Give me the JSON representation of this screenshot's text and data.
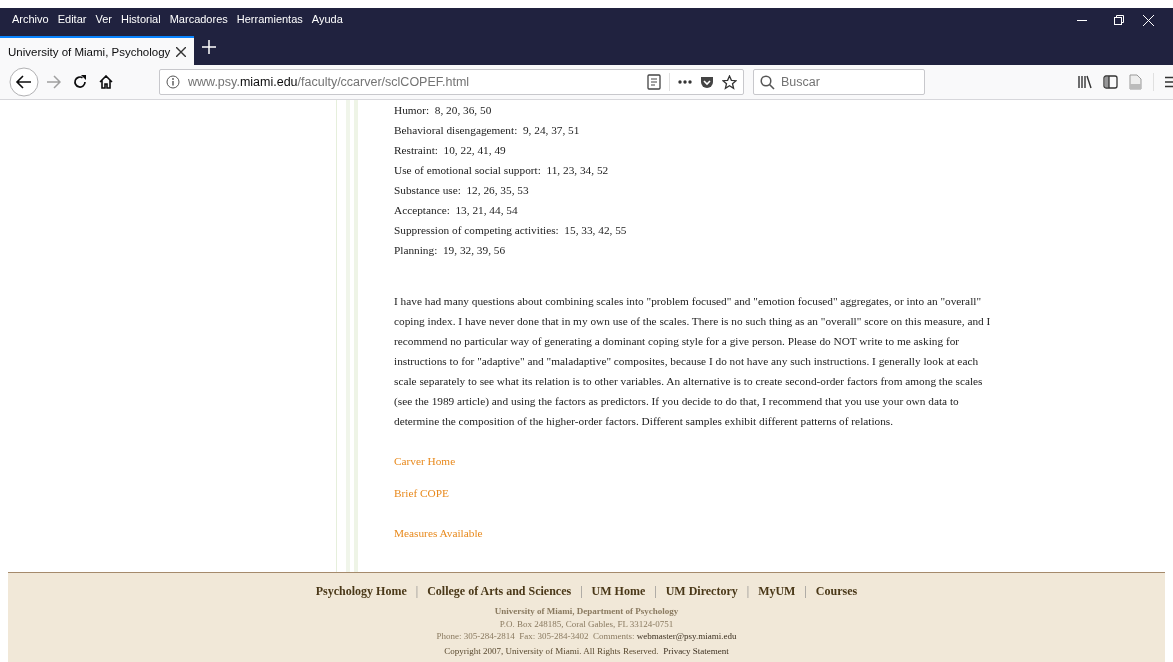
{
  "menu": [
    "Archivo",
    "Editar",
    "Ver",
    "Historial",
    "Marcadores",
    "Herramientas",
    "Ayuda"
  ],
  "tabs": [
    {
      "label": "University of Miami, Psychology",
      "selected": true
    }
  ],
  "address": {
    "prefix": "www.psy.",
    "domain": "miami.edu",
    "path": "/faculty/ccarver/sclCOPEF.html"
  },
  "search": {
    "placeholder": "Buscar"
  },
  "scales": [
    "Humor:  8, 20, 36, 50",
    "Behavioral disengagement:  9, 24, 37, 51",
    "Restraint:  10, 22, 41, 49",
    "Use of emotional social support:  11, 23, 34, 52",
    "Substance use:  12, 26, 35, 53",
    "Acceptance:  13, 21, 44, 54",
    "Suppression of competing activities:  15, 33, 42, 55",
    "Planning:  19, 32, 39, 56"
  ],
  "paragraph": "I have had many questions about combining scales into \"problem focused\" and \"emotion focused\" aggregates, or into an \"overall\" coping index. I have never done that in my own use of the scales. There is no such thing as an \"overall\" score on this measure, and I recommend no particular way of generating a dominant coping style for a give person. Please do NOT write to me asking for instructions to for \"adaptive\" and \"maladaptive\" composites, because I do not have any such instructions. I generally look at each scale separately to see what its relation is to other variables. An alternative is to create second-order factors from among the scales (see the 1989 article) and using the factors as predictors. If you decide to do that, I recommend that you use your own data to determine the composition of the higher-order factors. Different samples exhibit different patterns of relations.",
  "links": [
    "Carver Home",
    "Brief COPE",
    "Measures Available"
  ],
  "footer": {
    "nav": [
      "Psychology Home",
      "College of Arts and Sciences",
      "UM Home",
      "UM Directory",
      "MyUM",
      "Courses"
    ],
    "separator": "|",
    "org": "University of Miami, Department of Psychology",
    "address": "P.O. Box 248185, Coral Gables, FL 33124-0751",
    "contact": "Phone: 305-284-2814  Fax: 305-284-3402  Comments:",
    "email": "webmaster@psy.miami.edu",
    "copyright": "Copyright 2007, University of Miami. All Rights Reserved.",
    "privacy": "Privacy Statement"
  }
}
